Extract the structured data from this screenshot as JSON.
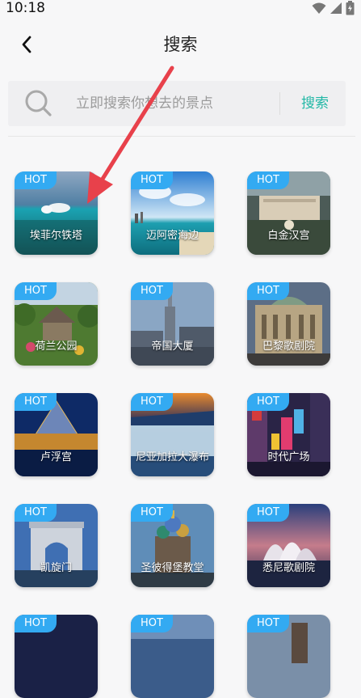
{
  "status_bar": {
    "time": "10:18"
  },
  "header": {
    "title": "搜索",
    "back_icon": "chevron-left-icon"
  },
  "search": {
    "placeholder": "立即搜索你想去的景点",
    "value": "",
    "button_label": "搜索",
    "icon": "search-icon"
  },
  "colors": {
    "accent": "#22b8a6",
    "hot_badge": "#33aaf2",
    "arrow": "#e8414b",
    "background": "#f7f7f8"
  },
  "places": [
    {
      "badge": "HOT",
      "name": "埃菲尔铁塔"
    },
    {
      "badge": "HOT",
      "name": "迈阿密海边"
    },
    {
      "badge": "HOT",
      "name": "白金汉宫"
    },
    {
      "badge": "HOT",
      "name": "荷兰公园"
    },
    {
      "badge": "HOT",
      "name": "帝国大厦"
    },
    {
      "badge": "HOT",
      "name": "巴黎歌剧院"
    },
    {
      "badge": "HOT",
      "name": "卢浮宫"
    },
    {
      "badge": "HOT",
      "name": "尼亚加拉大瀑布"
    },
    {
      "badge": "HOT",
      "name": "时代广场"
    },
    {
      "badge": "HOT",
      "name": "凯旋门"
    },
    {
      "badge": "HOT",
      "name": "圣彼得堡教堂"
    },
    {
      "badge": "HOT",
      "name": "悉尼歌剧院"
    },
    {
      "badge": "HOT",
      "name": ""
    },
    {
      "badge": "HOT",
      "name": ""
    },
    {
      "badge": "HOT",
      "name": ""
    }
  ]
}
